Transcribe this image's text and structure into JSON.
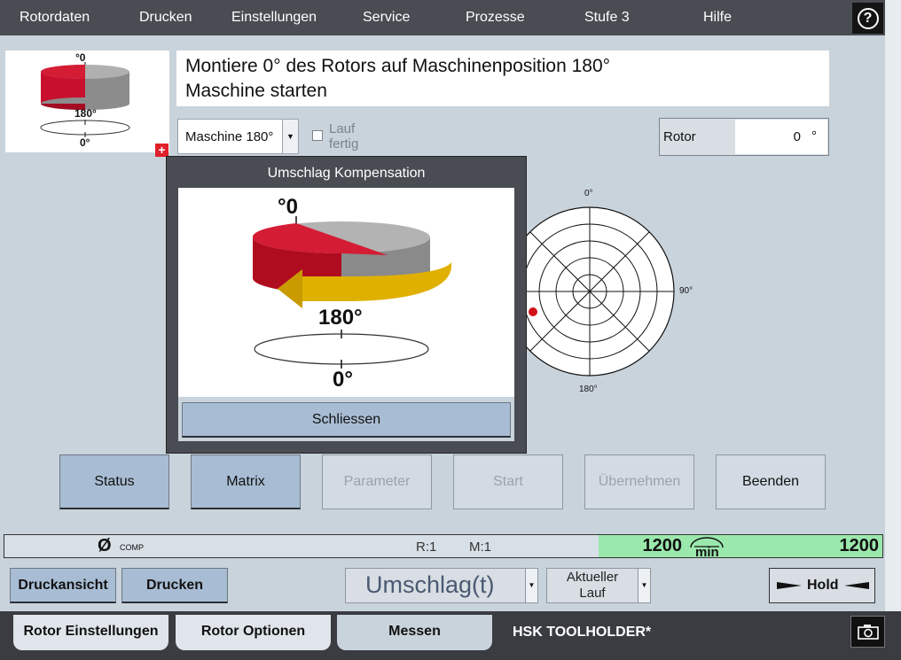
{
  "menu": {
    "items": [
      "Rotordaten",
      "Drucken",
      "Einstellungen",
      "Service",
      "Prozesse",
      "Stufe 3",
      "Hilfe"
    ],
    "help_icon": "question-circle-icon"
  },
  "thumbnail": {
    "top_label": "°0",
    "mid_label": "180°",
    "bottom_label": "0°",
    "plus_icon": "expand-plus-icon"
  },
  "instruction": {
    "line1": "Montiere 0° des Rotors auf Maschinenposition 180°",
    "line2": "Maschine starten"
  },
  "position_select": {
    "value": "Maschine 180°"
  },
  "lauf_fertig": {
    "line1": "Lauf",
    "line2": "fertig",
    "checked": false
  },
  "rotor_field": {
    "label": "Rotor",
    "value": "0",
    "unit": "°"
  },
  "polar_plot": {
    "label_top": "0°",
    "label_right": "90°",
    "label_bottom": "180°",
    "marker_color": "#d0121b"
  },
  "actions": {
    "status": "Status",
    "matrix": "Matrix",
    "parameter": "Parameter",
    "start": "Start",
    "uebernehmen": "Übernehmen",
    "beenden": "Beenden"
  },
  "statusbar": {
    "comp_icon": "Ø",
    "comp_label": "COMP",
    "r_label": "R:1",
    "m_label": "M:1",
    "speed_actual": "1200",
    "speed_unit": "min",
    "speed_target": "1200"
  },
  "bottom": {
    "druckansicht": "Druckansicht",
    "drucken": "Drucken",
    "mode": "Umschlag(t)",
    "lauf_line1": "Aktueller",
    "lauf_line2": "Lauf",
    "hold": "Hold"
  },
  "tabs": {
    "rotor_einstellungen": "Rotor Einstellungen",
    "rotor_optionen": "Rotor Optionen",
    "messen": "Messen",
    "tool": "HSK TOOLHOLDER*"
  },
  "modal": {
    "title": "Umschlag Kompensation",
    "top_label": "°0",
    "mid_label": "180°",
    "bottom_label": "0°",
    "close": "Schliessen"
  },
  "colors": {
    "accent_red": "#d0121b",
    "arrow_yellow": "#e0b000",
    "active_button": "#a8bdd4",
    "speed_green": "#9be8ad",
    "menubar": "#4a4c53"
  }
}
